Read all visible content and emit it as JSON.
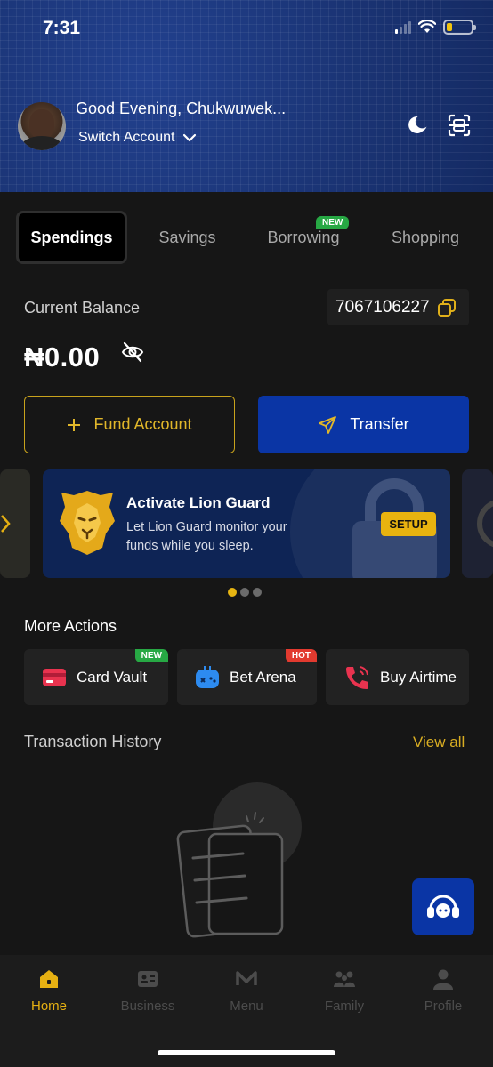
{
  "status_bar": {
    "time": "7:31"
  },
  "header": {
    "greeting": "Good Evening,  Chukwuwek...",
    "switch_account": "Switch Account"
  },
  "tabs": [
    {
      "label": "Spendings",
      "active": true
    },
    {
      "label": "Savings"
    },
    {
      "label": "Borrowing",
      "badge": "NEW"
    },
    {
      "label": "Shopping"
    }
  ],
  "balance": {
    "label": "Current Balance",
    "account_number": "7067106227",
    "amount": "₦0.00"
  },
  "buttons": {
    "fund": "Fund Account",
    "transfer": "Transfer"
  },
  "banner": {
    "title": "Activate Lion Guard",
    "text": "Let Lion Guard monitor your funds while you sleep.",
    "cta": "SETUP",
    "active_dot": 0
  },
  "more_actions": {
    "title": "More Actions",
    "items": [
      {
        "label": "Card Vault",
        "badge": "NEW"
      },
      {
        "label": "Bet Arena",
        "badge": "HOT"
      },
      {
        "label": "Buy Airtime"
      }
    ]
  },
  "transactions": {
    "title": "Transaction History",
    "view_all": "View all"
  },
  "bottom_nav": [
    {
      "label": "Home",
      "active": true
    },
    {
      "label": "Business"
    },
    {
      "label": "Menu"
    },
    {
      "label": "Family"
    },
    {
      "label": "Profile"
    }
  ],
  "colors": {
    "accent": "#e5b012",
    "primary": "#0a35a5",
    "background": "#161616"
  }
}
